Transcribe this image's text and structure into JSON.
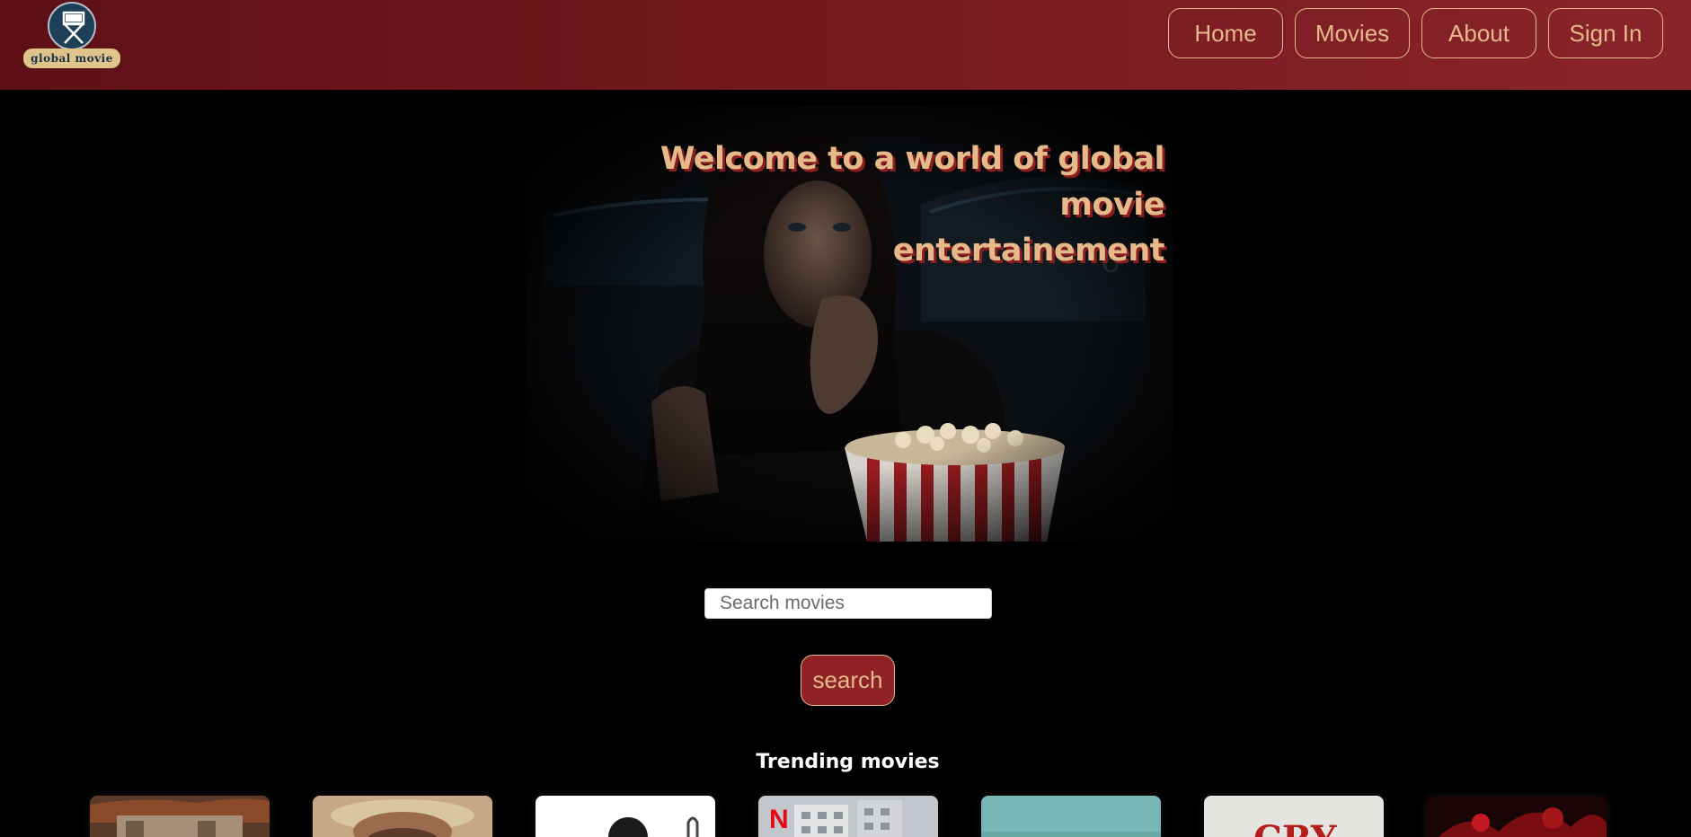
{
  "header": {
    "logo_text": "global movie",
    "nav": [
      {
        "label": "Home"
      },
      {
        "label": "Movies"
      },
      {
        "label": "About"
      },
      {
        "label": "Sign In"
      }
    ]
  },
  "hero": {
    "headline_line1": "Welcome to a world of global movie",
    "headline_line2": "entertainement"
  },
  "search": {
    "placeholder": "Search movies",
    "value": "",
    "button_label": "search"
  },
  "trending": {
    "title": "Trending movies",
    "posters": [
      {
        "icon": "poster-thumbnail"
      },
      {
        "icon": "poster-thumbnail"
      },
      {
        "icon": "poster-thumbnail"
      },
      {
        "icon": "poster-thumbnail",
        "badge": "N"
      },
      {
        "icon": "poster-thumbnail"
      },
      {
        "icon": "poster-thumbnail",
        "text": "CRY"
      },
      {
        "icon": "poster-thumbnail"
      }
    ]
  },
  "colors": {
    "accent": "#e6b98a",
    "header_bg": "#761b21",
    "button_bg": "#8f2226",
    "background": "#000000"
  }
}
